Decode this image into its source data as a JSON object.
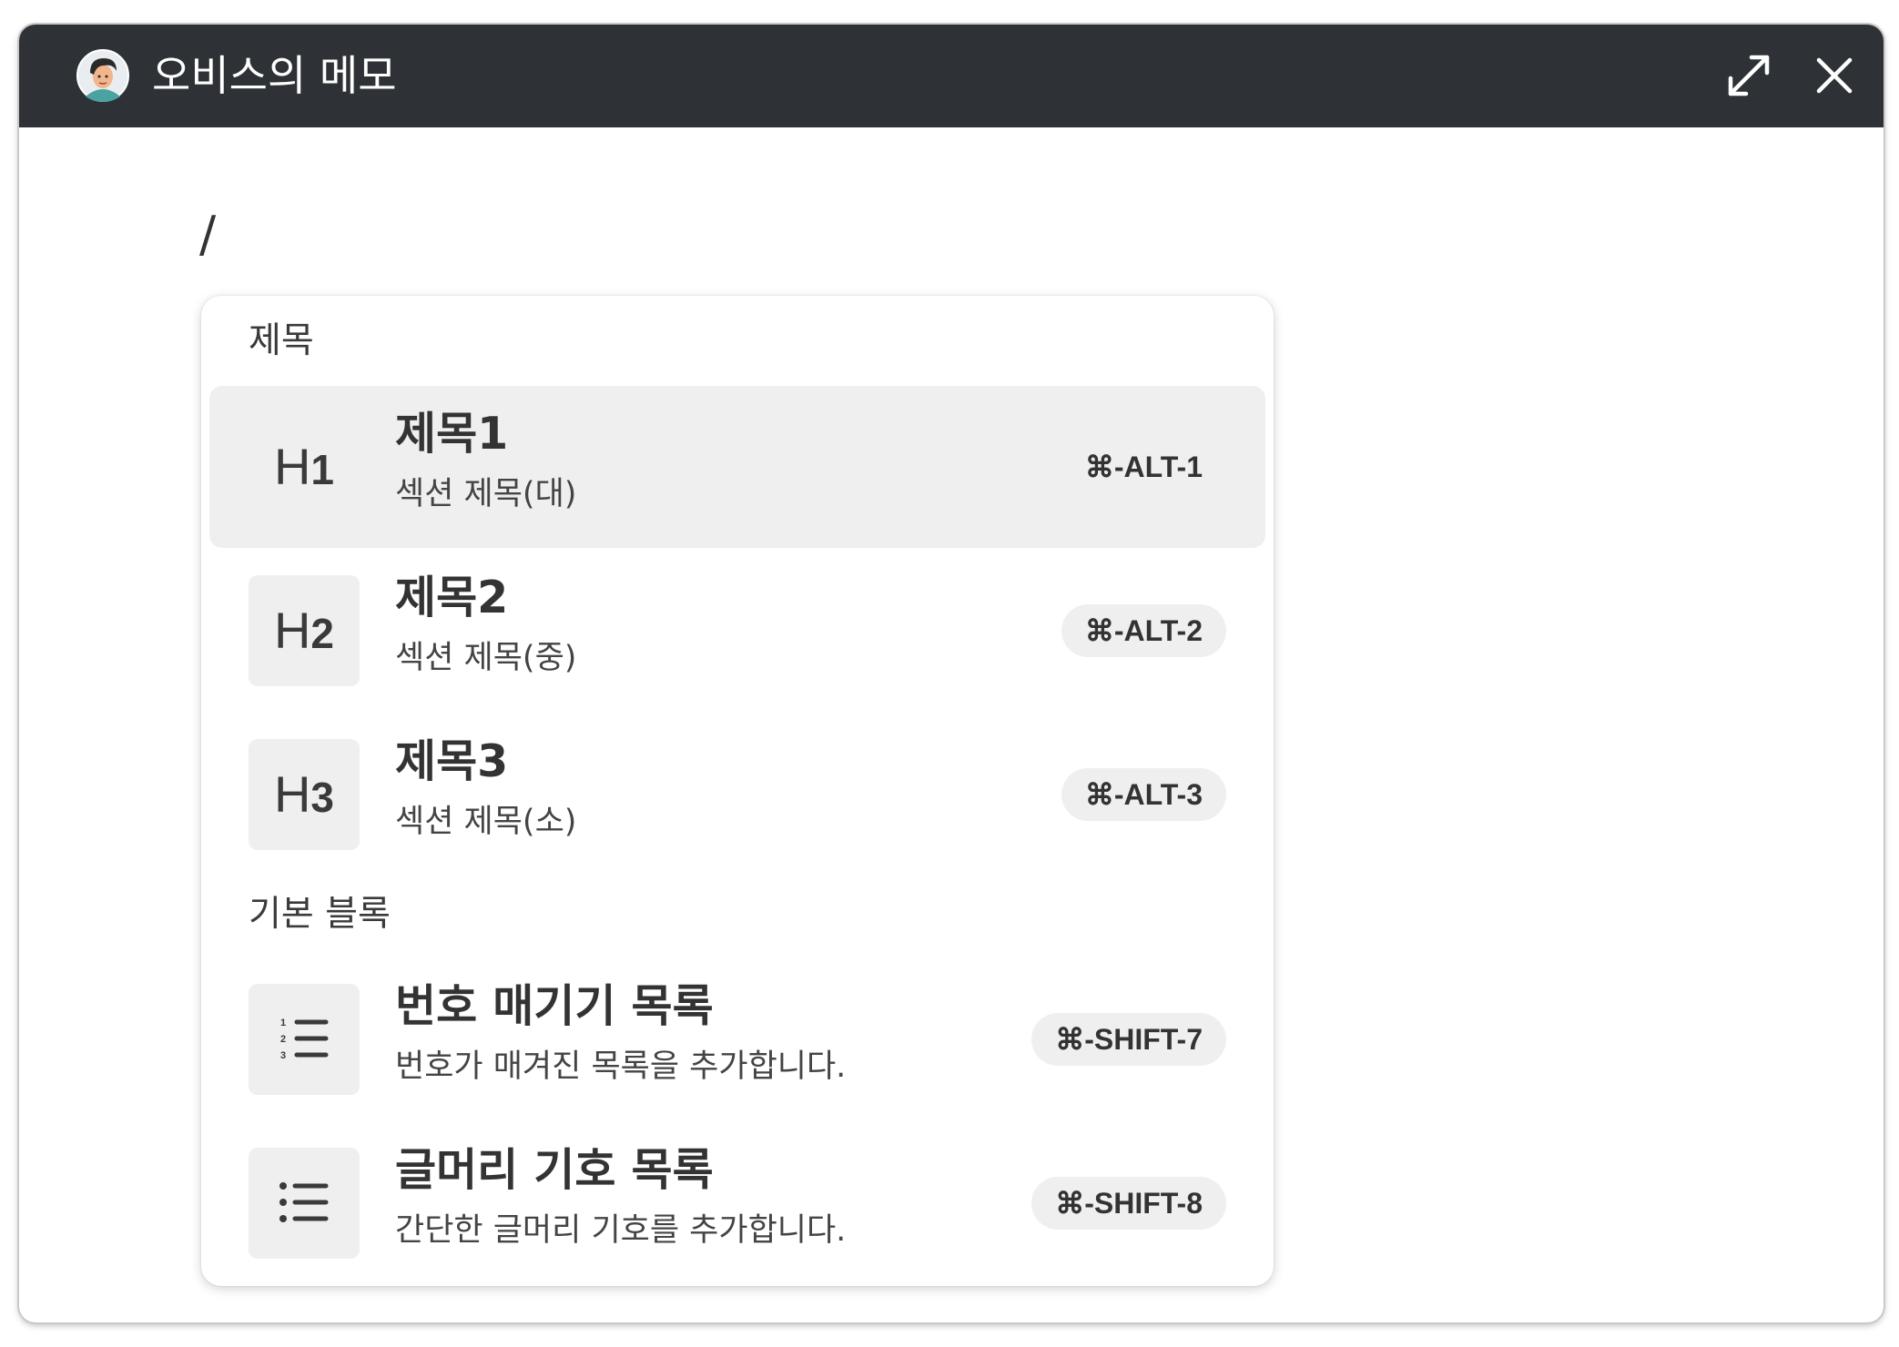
{
  "window": {
    "title": "오비스의 메모",
    "avatar_icon": "user-avatar",
    "expand_icon": "expand-arrows-icon",
    "close_icon": "close-icon"
  },
  "editor": {
    "typed_text": "/"
  },
  "menu": {
    "sections": [
      {
        "label": "제목",
        "items": [
          {
            "icon_text": "H",
            "icon_sub": "1",
            "name": "제목1",
            "description": "섹션 제목(대)",
            "shortcut": "⌘-ALT-1",
            "selected": true
          },
          {
            "icon_text": "H",
            "icon_sub": "2",
            "name": "제목2",
            "description": "섹션 제목(중)",
            "shortcut": "⌘-ALT-2",
            "selected": false
          },
          {
            "icon_text": "H",
            "icon_sub": "3",
            "name": "제목3",
            "description": "섹션 제목(소)",
            "shortcut": "⌘-ALT-3",
            "selected": false
          }
        ]
      },
      {
        "label": "기본 블록",
        "items": [
          {
            "icon": "numbered-list-icon",
            "name": "번호 매기기 목록",
            "description": "번호가 매겨진 목록을 추가합니다.",
            "shortcut": "⌘-SHIFT-7",
            "selected": false
          },
          {
            "icon": "bulleted-list-icon",
            "name": "글머리 기호 목록",
            "description": "간단한 글머리 기호를 추가합니다.",
            "shortcut": "⌘-SHIFT-8",
            "selected": false
          }
        ]
      }
    ]
  },
  "colors": {
    "titlebar": "#2e3236",
    "selected_bg": "#efefef",
    "text": "#333333"
  }
}
